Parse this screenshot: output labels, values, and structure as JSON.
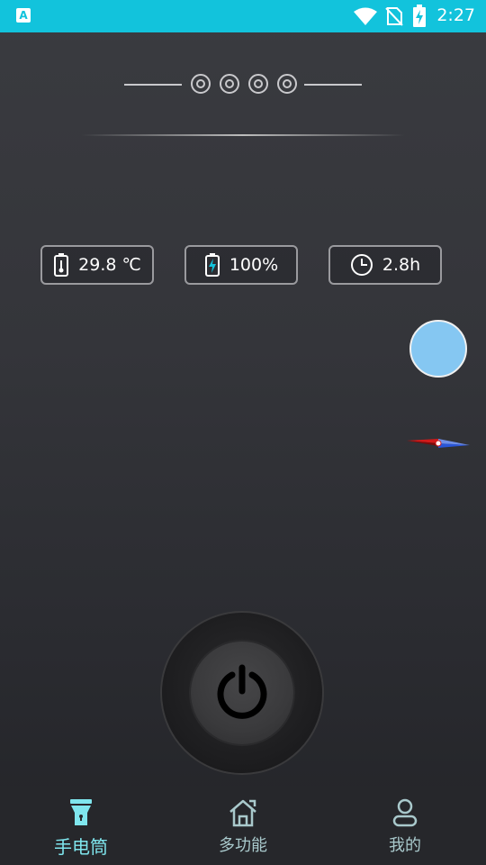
{
  "status_bar": {
    "time": "2:27",
    "app_badge": "A"
  },
  "stats": {
    "temperature": "29.8 ℃",
    "battery": "100%",
    "time_remaining": "2.8h"
  },
  "nav": {
    "flashlight": "手电筒",
    "multi_function": "多功能",
    "mine": "我的"
  },
  "colors": {
    "status_bar": "#12c3dc",
    "active_tab": "#7fe6ee",
    "float_circle": "#85c7f2"
  }
}
